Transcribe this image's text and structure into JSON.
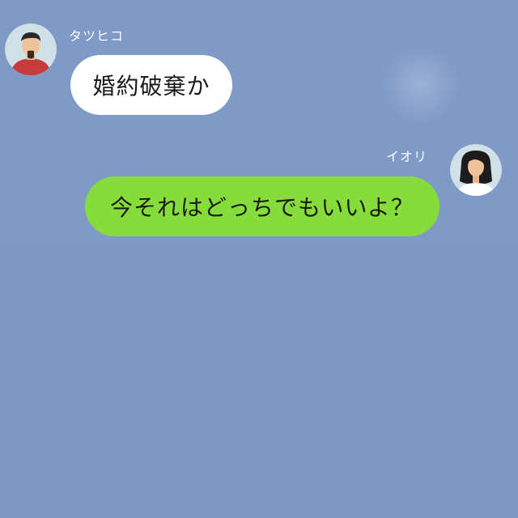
{
  "messages": [
    {
      "sender": "タツヒコ",
      "text": "婚約破棄か",
      "side": "left",
      "avatar_icon": "man-avatar-icon",
      "bubble_color": "#ffffff"
    },
    {
      "sender": "イオリ",
      "text": "今それはどっちでもいいよ？",
      "side": "right",
      "avatar_icon": "woman-avatar-icon",
      "bubble_color": "#86dc3a"
    }
  ],
  "colors": {
    "background": "#7f9ac7",
    "incoming_bubble": "#ffffff",
    "outgoing_bubble": "#86dc3a",
    "name_text": "#ffffff"
  }
}
